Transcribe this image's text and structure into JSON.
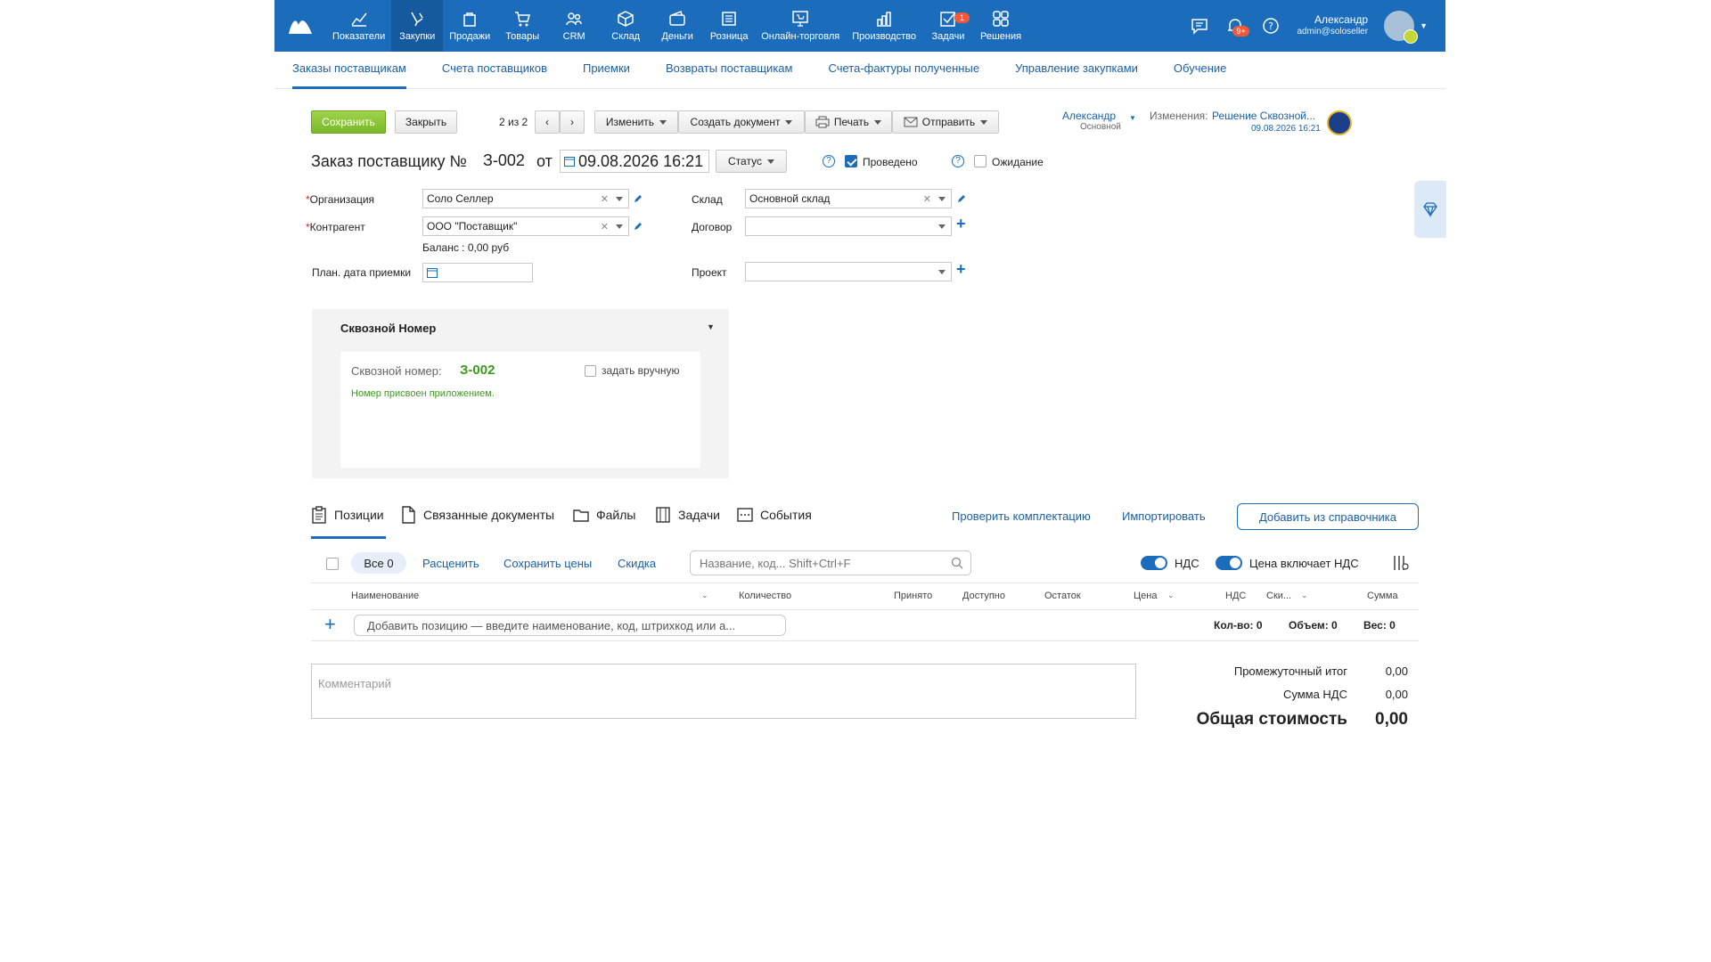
{
  "topnav": {
    "items": [
      {
        "label": "Показатели"
      },
      {
        "label": "Закупки"
      },
      {
        "label": "Продажи"
      },
      {
        "label": "Товары"
      },
      {
        "label": "CRM"
      },
      {
        "label": "Склад"
      },
      {
        "label": "Деньги"
      },
      {
        "label": "Розница"
      },
      {
        "label": "Онлайн-торговля"
      },
      {
        "label": "Производство"
      },
      {
        "label": "Задачи",
        "badge": "1"
      },
      {
        "label": "Решения"
      }
    ],
    "notifications_badge": "9+",
    "user_name": "Александр",
    "user_email": "admin@soloseller"
  },
  "subnav": {
    "items": [
      {
        "label": "Заказы поставщикам"
      },
      {
        "label": "Счета поставщиков"
      },
      {
        "label": "Приемки"
      },
      {
        "label": "Возвраты поставщикам"
      },
      {
        "label": "Счета-фактуры полученные"
      },
      {
        "label": "Управление закупками"
      },
      {
        "label": "Обучение"
      }
    ]
  },
  "toolbar": {
    "save": "Сохранить",
    "close": "Закрыть",
    "pager": "2 из 2",
    "change": "Изменить",
    "create_doc": "Создать документ",
    "print": "Печать",
    "send": "Отправить",
    "owner_name": "Александр",
    "owner_role": "Основной",
    "changes_label": "Изменения:",
    "changes_by": "Решение Сквозной...",
    "changes_date": "09.08.2026 16:21"
  },
  "doc": {
    "title": "Заказ поставщику №",
    "number": "З-002",
    "from": "от",
    "datetime": "09.08.2026 16:21",
    "status": "Статус",
    "posted": "Проведено",
    "waiting": "Ожидание"
  },
  "form": {
    "org_label": "Организация",
    "org_value": "Соло Селлер",
    "counterparty_label": "Контрагент",
    "counterparty_value": "ООО \"Поставщик\"",
    "balance": "Баланс : 0,00 руб",
    "plan_date_label": "План. дата приемки",
    "warehouse_label": "Склад",
    "warehouse_value": "Основной склад",
    "contract_label": "Договор",
    "project_label": "Проект"
  },
  "through_panel": {
    "title": "Сквозной Номер",
    "number_label": "Сквозной номер:",
    "number_value": "З-002",
    "manual_label": "задать вручную",
    "note": "Номер присвоен приложением."
  },
  "tabs": [
    {
      "label": "Позиции"
    },
    {
      "label": "Связанные документы"
    },
    {
      "label": "Файлы"
    },
    {
      "label": "Задачи"
    },
    {
      "label": "События"
    }
  ],
  "tab_actions": {
    "check": "Проверить комплектацию",
    "import": "Импортировать",
    "add_from": "Добавить из справочника"
  },
  "list_toolbar": {
    "all": "Все 0",
    "reprice": "Расценить",
    "save_prices": "Сохранить цены",
    "discount": "Скидка",
    "search_placeholder": "Название, код... Shift+Ctrl+F",
    "vat": "НДС",
    "price_incl_vat": "Цена включает НДС"
  },
  "columns": {
    "name": "Наименование",
    "qty": "Количество",
    "accepted": "Принято",
    "available": "Доступно",
    "rest": "Остаток",
    "price": "Цена",
    "vat": "НДС",
    "discount": "Ски...",
    "sum": "Сумма"
  },
  "add_row": {
    "placeholder": "Добавить позицию — введите наименование, код, штрихкод или а...",
    "qty": "Кол-во: 0",
    "volume": "Объем: 0",
    "weight": "Вес: 0"
  },
  "comment_placeholder": "Комментарий",
  "totals": {
    "subtotal_label": "Промежуточный итог",
    "subtotal": "0,00",
    "vat_label": "Сумма НДС",
    "vat": "0,00",
    "total_label": "Общая стоимость",
    "total": "0,00"
  },
  "colors": {
    "brand": "#1b6dbc",
    "save_green": "#79b82a",
    "through_number": "#3a9a1c"
  }
}
